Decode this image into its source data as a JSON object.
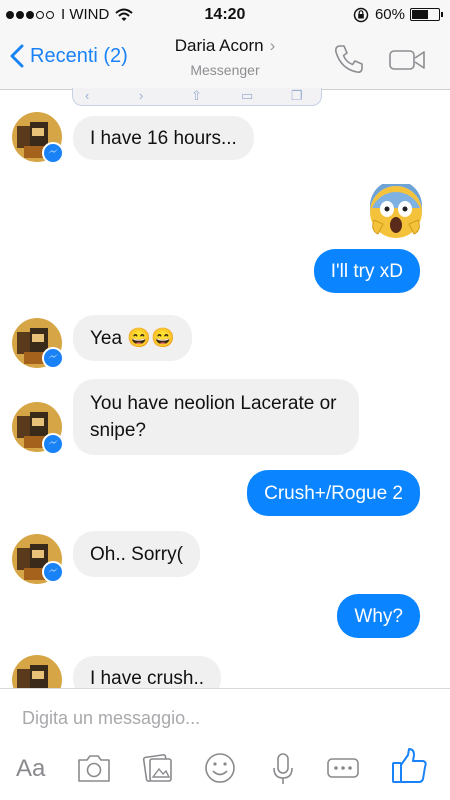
{
  "status": {
    "carrier": "I WIND",
    "time": "14:20",
    "battery": "60%",
    "battery_level": 0.6
  },
  "header": {
    "back_label": "Recenti (2)",
    "title": "Daria Acorn",
    "subtitle": "Messenger"
  },
  "messages": [
    {
      "dir": "in",
      "text": "I have 16 hours..."
    },
    {
      "dir": "out",
      "text": "😱",
      "emoji": true
    },
    {
      "dir": "out",
      "text": "I'll try xD"
    },
    {
      "dir": "in",
      "text": "Yea 😄😄"
    },
    {
      "dir": "in",
      "text": "You have neolion Lacerate or snipe?"
    },
    {
      "dir": "out",
      "text": "Crush+/Rogue 2"
    },
    {
      "dir": "in",
      "text": "Oh.. Sorry("
    },
    {
      "dir": "out",
      "text": "Why?"
    },
    {
      "dir": "in",
      "text": "I have crush.."
    }
  ],
  "composer": {
    "placeholder": "Digita un messaggio...",
    "aa_label": "Aa"
  },
  "colors": {
    "accent": "#1a82f7",
    "outgoing": "#0b84ff",
    "incoming": "#f0f0f0"
  },
  "icons": [
    "back-chevron-icon",
    "phone-icon",
    "video-camera-icon",
    "camera-icon",
    "gallery-icon",
    "smiley-icon",
    "microphone-icon",
    "more-icon",
    "thumbs-up-icon",
    "messenger-badge-icon"
  ]
}
